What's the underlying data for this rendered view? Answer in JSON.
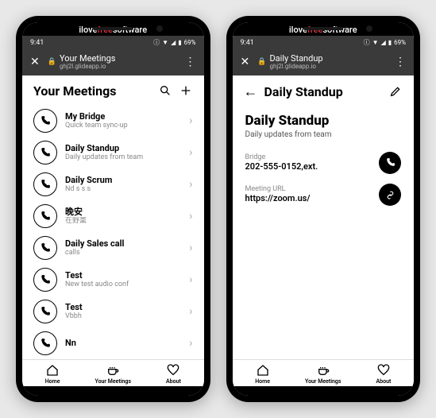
{
  "watermark": {
    "prefix": "ilove",
    "mid": "free",
    "suffix": "software"
  },
  "statusbar": {
    "time": "9:41",
    "battery": "69%"
  },
  "left": {
    "appbar": {
      "title": "Your Meetings",
      "subtitle": "ghj2l.glideapp.io"
    },
    "page_title": "Your Meetings",
    "items": [
      {
        "title": "My Bridge",
        "subtitle": "Quick team sync-up"
      },
      {
        "title": "Daily Standup",
        "subtitle": "Daily updates from team"
      },
      {
        "title": "Daily Scrum",
        "subtitle": "Nd s s s"
      },
      {
        "title": "晚安",
        "subtitle": "在野黨"
      },
      {
        "title": "Daily Sales call",
        "subtitle": "calls"
      },
      {
        "title": "Test",
        "subtitle": "New test audio conf"
      },
      {
        "title": "Test",
        "subtitle": "Vbbh"
      },
      {
        "title": "Nn",
        "subtitle": ""
      }
    ]
  },
  "right": {
    "appbar": {
      "title": "Daily Standup",
      "subtitle": "ghj2l.glideapp.io"
    },
    "page_title": "Daily Standup",
    "detail_title": "Daily Standup",
    "detail_subtitle": "Daily updates from team",
    "bridge": {
      "label": "Bridge",
      "value": "202-555-0152,ext."
    },
    "url": {
      "label": "Meeting URL",
      "value": "https://zoom.us/"
    }
  },
  "nav": {
    "home": "Home",
    "meetings": "Your Meetings",
    "about": "About"
  }
}
